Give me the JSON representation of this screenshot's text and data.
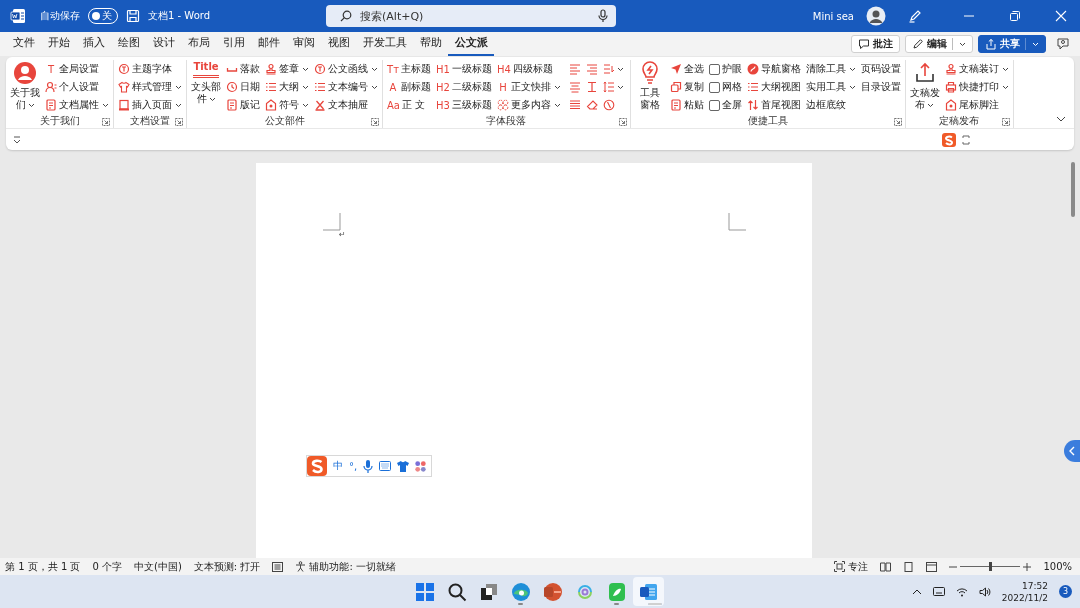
{
  "window": {
    "title": "文档1  -  Word",
    "autosave": {
      "label": "自动保存",
      "on": false,
      "state_text": "关"
    },
    "search": {
      "placeholder": "搜索(Alt+Q)"
    },
    "user": "Mini sea"
  },
  "tabs": [
    {
      "label": "文件",
      "selected": false
    },
    {
      "label": "开始",
      "selected": false
    },
    {
      "label": "插入",
      "selected": false
    },
    {
      "label": "绘图",
      "selected": false
    },
    {
      "label": "设计",
      "selected": false
    },
    {
      "label": "布局",
      "selected": false
    },
    {
      "label": "引用",
      "selected": false
    },
    {
      "label": "邮件",
      "selected": false
    },
    {
      "label": "审阅",
      "selected": false
    },
    {
      "label": "视图",
      "selected": false
    },
    {
      "label": "开发工具",
      "selected": false
    },
    {
      "label": "帮助",
      "selected": false
    },
    {
      "label": "公文派",
      "selected": true
    }
  ],
  "tab_actions": [
    {
      "kind": "comment",
      "label": "批注",
      "dropdown": false
    },
    {
      "kind": "edit",
      "label": "编辑",
      "dropdown": true
    },
    {
      "kind": "share",
      "label": "共享",
      "dropdown": true
    }
  ],
  "ribbon": [
    {
      "label": "关于我们",
      "columns": [
        {
          "kind": "large",
          "label_lines": [
            "关于我",
            "们"
          ],
          "dropdown": true
        },
        {
          "kind": "stack",
          "items": [
            {
              "kind": "small",
              "glyph": "T",
              "label": "全局设置",
              "dropdown": false
            },
            {
              "kind": "small",
              "label": "个人设置",
              "dropdown": false
            },
            {
              "kind": "small",
              "label": "文档属性",
              "dropdown": true
            }
          ]
        }
      ]
    },
    {
      "label": "文档设置",
      "columns": [
        {
          "kind": "stack",
          "items": [
            {
              "kind": "small",
              "label": "主题字体",
              "dropdown": false
            },
            {
              "kind": "small",
              "label": "样式管理",
              "dropdown": true
            },
            {
              "kind": "small",
              "label": "插入页面",
              "dropdown": true
            }
          ]
        }
      ]
    },
    {
      "label": "公文部件",
      "columns": [
        {
          "kind": "large",
          "glyph": "Title",
          "label_lines": [
            "文头部",
            "件"
          ],
          "dropdown": true
        },
        {
          "kind": "stack",
          "items": [
            {
              "kind": "small",
              "label": "落款",
              "dropdown": false
            },
            {
              "kind": "small",
              "label": "日期",
              "dropdown": false
            },
            {
              "kind": "small",
              "label": "版记",
              "dropdown": false
            }
          ]
        },
        {
          "kind": "stack",
          "items": [
            {
              "kind": "small",
              "label": "签章",
              "dropdown": true
            },
            {
              "kind": "small",
              "label": "大纲",
              "dropdown": true
            },
            {
              "kind": "small",
              "label": "符号",
              "dropdown": true
            }
          ]
        },
        {
          "kind": "stack",
          "items": [
            {
              "kind": "small",
              "label": "公文函线",
              "dropdown": true
            },
            {
              "kind": "small",
              "label": "文本编号",
              "dropdown": true
            },
            {
              "kind": "small",
              "label": "文本抽屉",
              "dropdown": false
            }
          ]
        }
      ]
    },
    {
      "label": "字体段落",
      "columns": [
        {
          "kind": "stack",
          "items": [
            {
              "kind": "small",
              "glyph": "Tт",
              "label": "主标题",
              "dropdown": false
            },
            {
              "kind": "small",
              "glyph": "A",
              "label": "副标题",
              "dropdown": false
            },
            {
              "kind": "small",
              "glyph": "Aa",
              "label": "正  文",
              "dropdown": false
            }
          ]
        },
        {
          "kind": "stack",
          "items": [
            {
              "kind": "small",
              "glyph": "H1",
              "label": "一级标题",
              "dropdown": false
            },
            {
              "kind": "small",
              "glyph": "H2",
              "label": "二级标题",
              "dropdown": false
            },
            {
              "kind": "small",
              "glyph": "H3",
              "label": "三级标题",
              "dropdown": false
            }
          ]
        },
        {
          "kind": "stack",
          "items": [
            {
              "kind": "small",
              "glyph": "H4",
              "label": "四级标题",
              "dropdown": false
            },
            {
              "kind": "small",
              "glyph": "H",
              "label": "正文快排",
              "dropdown": true
            },
            {
              "kind": "small",
              "label": "更多内容",
              "dropdown": true
            }
          ]
        },
        {
          "kind": "align"
        }
      ]
    },
    {
      "label": "便捷工具",
      "columns": [
        {
          "kind": "large",
          "label_lines": [
            "工具",
            "窗格"
          ],
          "dropdown": false
        },
        {
          "kind": "stack",
          "items": [
            {
              "kind": "small",
              "label": "全选",
              "dropdown": false
            },
            {
              "kind": "small",
              "label": "复制",
              "dropdown": false
            },
            {
              "kind": "small",
              "label": "粘贴",
              "dropdown": false
            }
          ]
        },
        {
          "kind": "stack",
          "items": [
            {
              "kind": "check",
              "label": "护眼",
              "checked": false
            },
            {
              "kind": "check",
              "label": "网格",
              "checked": false
            },
            {
              "kind": "check",
              "label": "全屏",
              "checked": false
            }
          ]
        },
        {
          "kind": "stack",
          "items": [
            {
              "kind": "small",
              "label": "导航窗格",
              "dropdown": false
            },
            {
              "kind": "small",
              "label": "大纲视图",
              "dropdown": false
            },
            {
              "kind": "small",
              "label": "首尾视图",
              "dropdown": false
            }
          ]
        },
        {
          "kind": "stack",
          "items": [
            {
              "kind": "text",
              "label": "清除工具",
              "dropdown": true
            },
            {
              "kind": "text",
              "label": "实用工具",
              "dropdown": true
            },
            {
              "kind": "text",
              "label": "边框底纹",
              "dropdown": false
            }
          ]
        },
        {
          "kind": "stack",
          "items": [
            {
              "kind": "text",
              "label": "页码设置",
              "dropdown": false
            },
            {
              "kind": "text",
              "label": "目录设置",
              "dropdown": false
            }
          ]
        }
      ]
    },
    {
      "label": "定稿发布",
      "columns": [
        {
          "kind": "large",
          "label_lines": [
            "文稿发",
            "布"
          ],
          "dropdown": true
        },
        {
          "kind": "stack",
          "items": [
            {
              "kind": "small",
              "label": "文稿装订",
              "dropdown": true
            },
            {
              "kind": "small",
              "label": "快捷打印",
              "dropdown": true
            },
            {
              "kind": "small",
              "label": "尾标脚注",
              "dropdown": false
            }
          ]
        }
      ]
    }
  ],
  "document": {
    "paragraph_mark": "↵"
  },
  "ime_bar": {
    "mode": "中",
    "punctuation": "°,"
  },
  "status_bar": {
    "items": [
      "第 1 页，共 1 页",
      "0 个字",
      "中文(中国)",
      "文本预测: 打开"
    ],
    "accessibility": "辅助功能: 一切就绪",
    "focus": "专注",
    "zoom_slider": {
      "level": 0.5
    },
    "zoom": "100%"
  },
  "taskbar": {
    "apps": [
      {
        "running": false,
        "active": false
      },
      {
        "running": false,
        "active": false
      },
      {
        "running": false,
        "active": false
      },
      {
        "running": true,
        "active": false
      },
      {
        "running": false,
        "active": false
      },
      {
        "running": false,
        "active": false
      },
      {
        "running": true,
        "active": false
      },
      {
        "running": true,
        "active": true
      }
    ],
    "time": "17:52",
    "date": "2022/11/2",
    "badge": "3"
  }
}
